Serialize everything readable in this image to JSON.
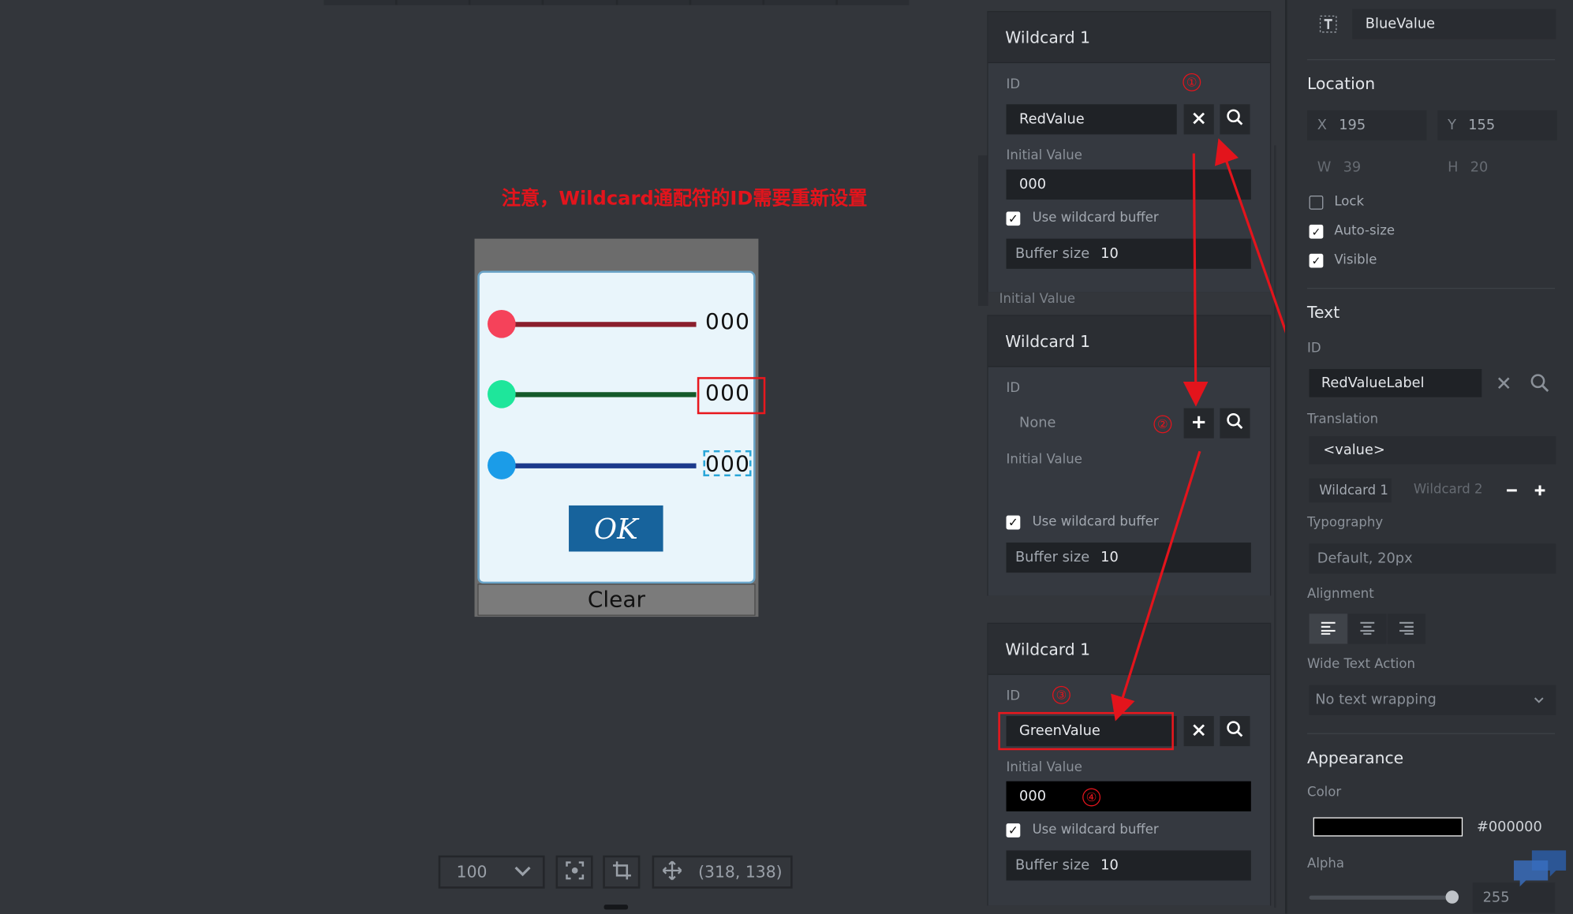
{
  "canvas": {
    "annotation_note": "注意，Wildcard通配符的ID需要重新设置",
    "rows": [
      {
        "value": "000",
        "color": "#f5425a"
      },
      {
        "value": "000",
        "color": "#1ee69b"
      },
      {
        "value": "000",
        "color": "#1b9ce8"
      }
    ],
    "ok_label": "OK",
    "clear_label": "Clear"
  },
  "bottom_toolbar": {
    "zoom": "100",
    "coordinates": "(318, 138)"
  },
  "panels": [
    {
      "title": "Wildcard 1",
      "id_label": "ID",
      "id_value": "RedValue",
      "initial_label": "Initial Value",
      "initial_value": "000",
      "wildcard_buffer_label": "Use wildcard buffer",
      "buffer_label": "Buffer size",
      "buffer_value": "10",
      "step": "①"
    },
    {
      "title": "Wildcard 1",
      "id_label": "ID",
      "id_value": "None",
      "initial_label": "Initial Value",
      "wildcard_buffer_label": "Use wildcard buffer",
      "buffer_label": "Buffer size",
      "buffer_value": "10",
      "step": "②"
    },
    {
      "title": "Wildcard 1",
      "id_label": "ID",
      "id_value": "GreenValue",
      "initial_label": "Initial Value",
      "initial_value": "000",
      "wildcard_buffer_label": "Use wildcard buffer",
      "buffer_label": "Buffer size",
      "buffer_value": "10",
      "step_id": "③",
      "step_initial": "④"
    }
  ],
  "background_panel_label": "Initial Value",
  "properties": {
    "name": "BlueValue",
    "location_title": "Location",
    "x_label": "X",
    "x_value": "195",
    "y_label": "Y",
    "y_value": "155",
    "w_label": "W",
    "w_value": "39",
    "h_label": "H",
    "h_value": "20",
    "lock_label": "Lock",
    "autosize_label": "Auto-size",
    "visible_label": "Visible",
    "text_title": "Text",
    "id_label": "ID",
    "id_value": "RedValueLabel",
    "translation_label": "Translation",
    "translation_value": "<value>",
    "wildcard1_tab": "Wildcard 1",
    "wildcard2_tab": "Wildcard 2",
    "typography_label": "Typography",
    "typography_value": "Default, 20px",
    "alignment_label": "Alignment",
    "wide_text_label": "Wide Text Action",
    "wide_text_value": "No text wrapping",
    "appearance_title": "Appearance",
    "color_label": "Color",
    "color_value": "#000000",
    "alpha_label": "Alpha",
    "alpha_value": "255"
  }
}
